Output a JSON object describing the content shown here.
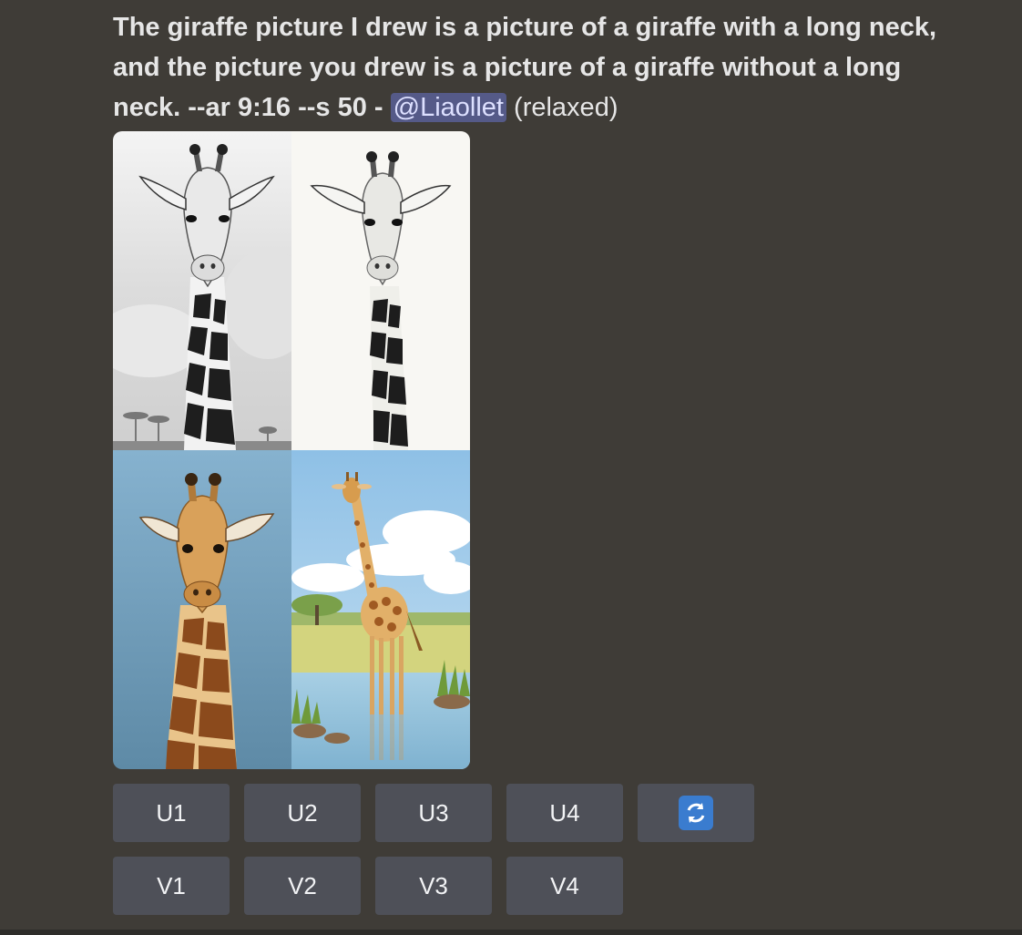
{
  "message": {
    "prompt_text": "The giraffe picture I drew is a picture of a giraffe with a long neck, and the picture you drew is a picture of a giraffe without a long neck. --ar 9:16 --s 50",
    "separator": " - ",
    "mention": "@Liaollet",
    "status": "(relaxed)"
  },
  "images": [
    {
      "name": "giraffe-sketch-gray-background"
    },
    {
      "name": "giraffe-sketch-white-background"
    },
    {
      "name": "giraffe-head-blue-background"
    },
    {
      "name": "giraffe-full-body-lake"
    }
  ],
  "buttons": {
    "upscale": [
      "U1",
      "U2",
      "U3",
      "U4"
    ],
    "variation": [
      "V1",
      "V2",
      "V3",
      "V4"
    ],
    "reroll_icon": "refresh-icon"
  },
  "colors": {
    "background": "#3f3c37",
    "button": "#4e5058",
    "mention_bg": "#555a88",
    "refresh_icon": "#3a7ccf"
  }
}
